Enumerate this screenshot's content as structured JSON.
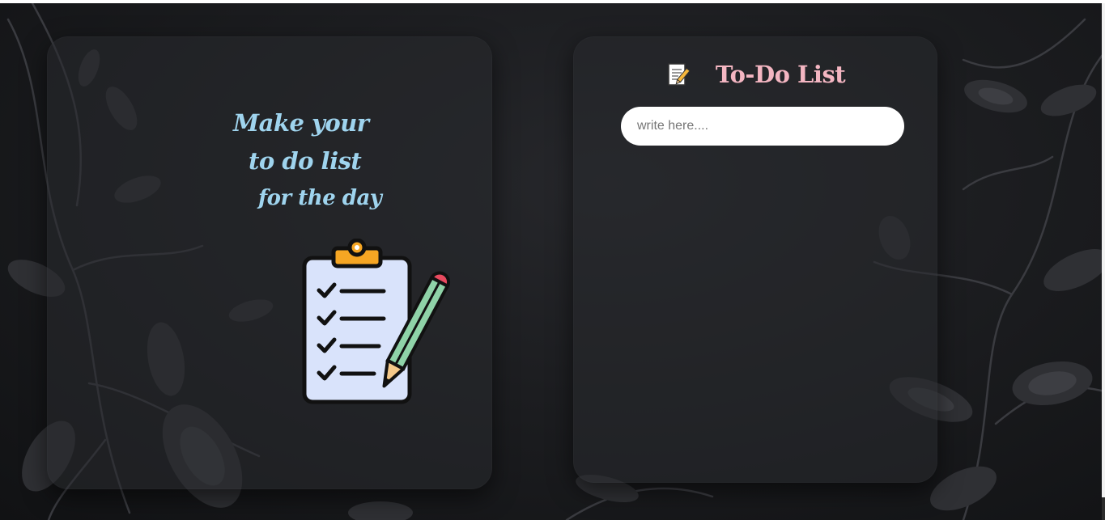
{
  "hero": {
    "line1": "Make your",
    "line2": "to do list",
    "line3": "for the day",
    "illustration": "clipboard-checklist-with-pencil"
  },
  "todo": {
    "icon": "memo-icon",
    "title": "To-Do List",
    "input": {
      "placeholder": "write here....",
      "value": ""
    },
    "items": []
  },
  "colors": {
    "tagline": "#9fd4ee",
    "title": "#f4b6c2",
    "background": "#1c1d20",
    "card": "#28292e",
    "input": "#ffffff"
  }
}
